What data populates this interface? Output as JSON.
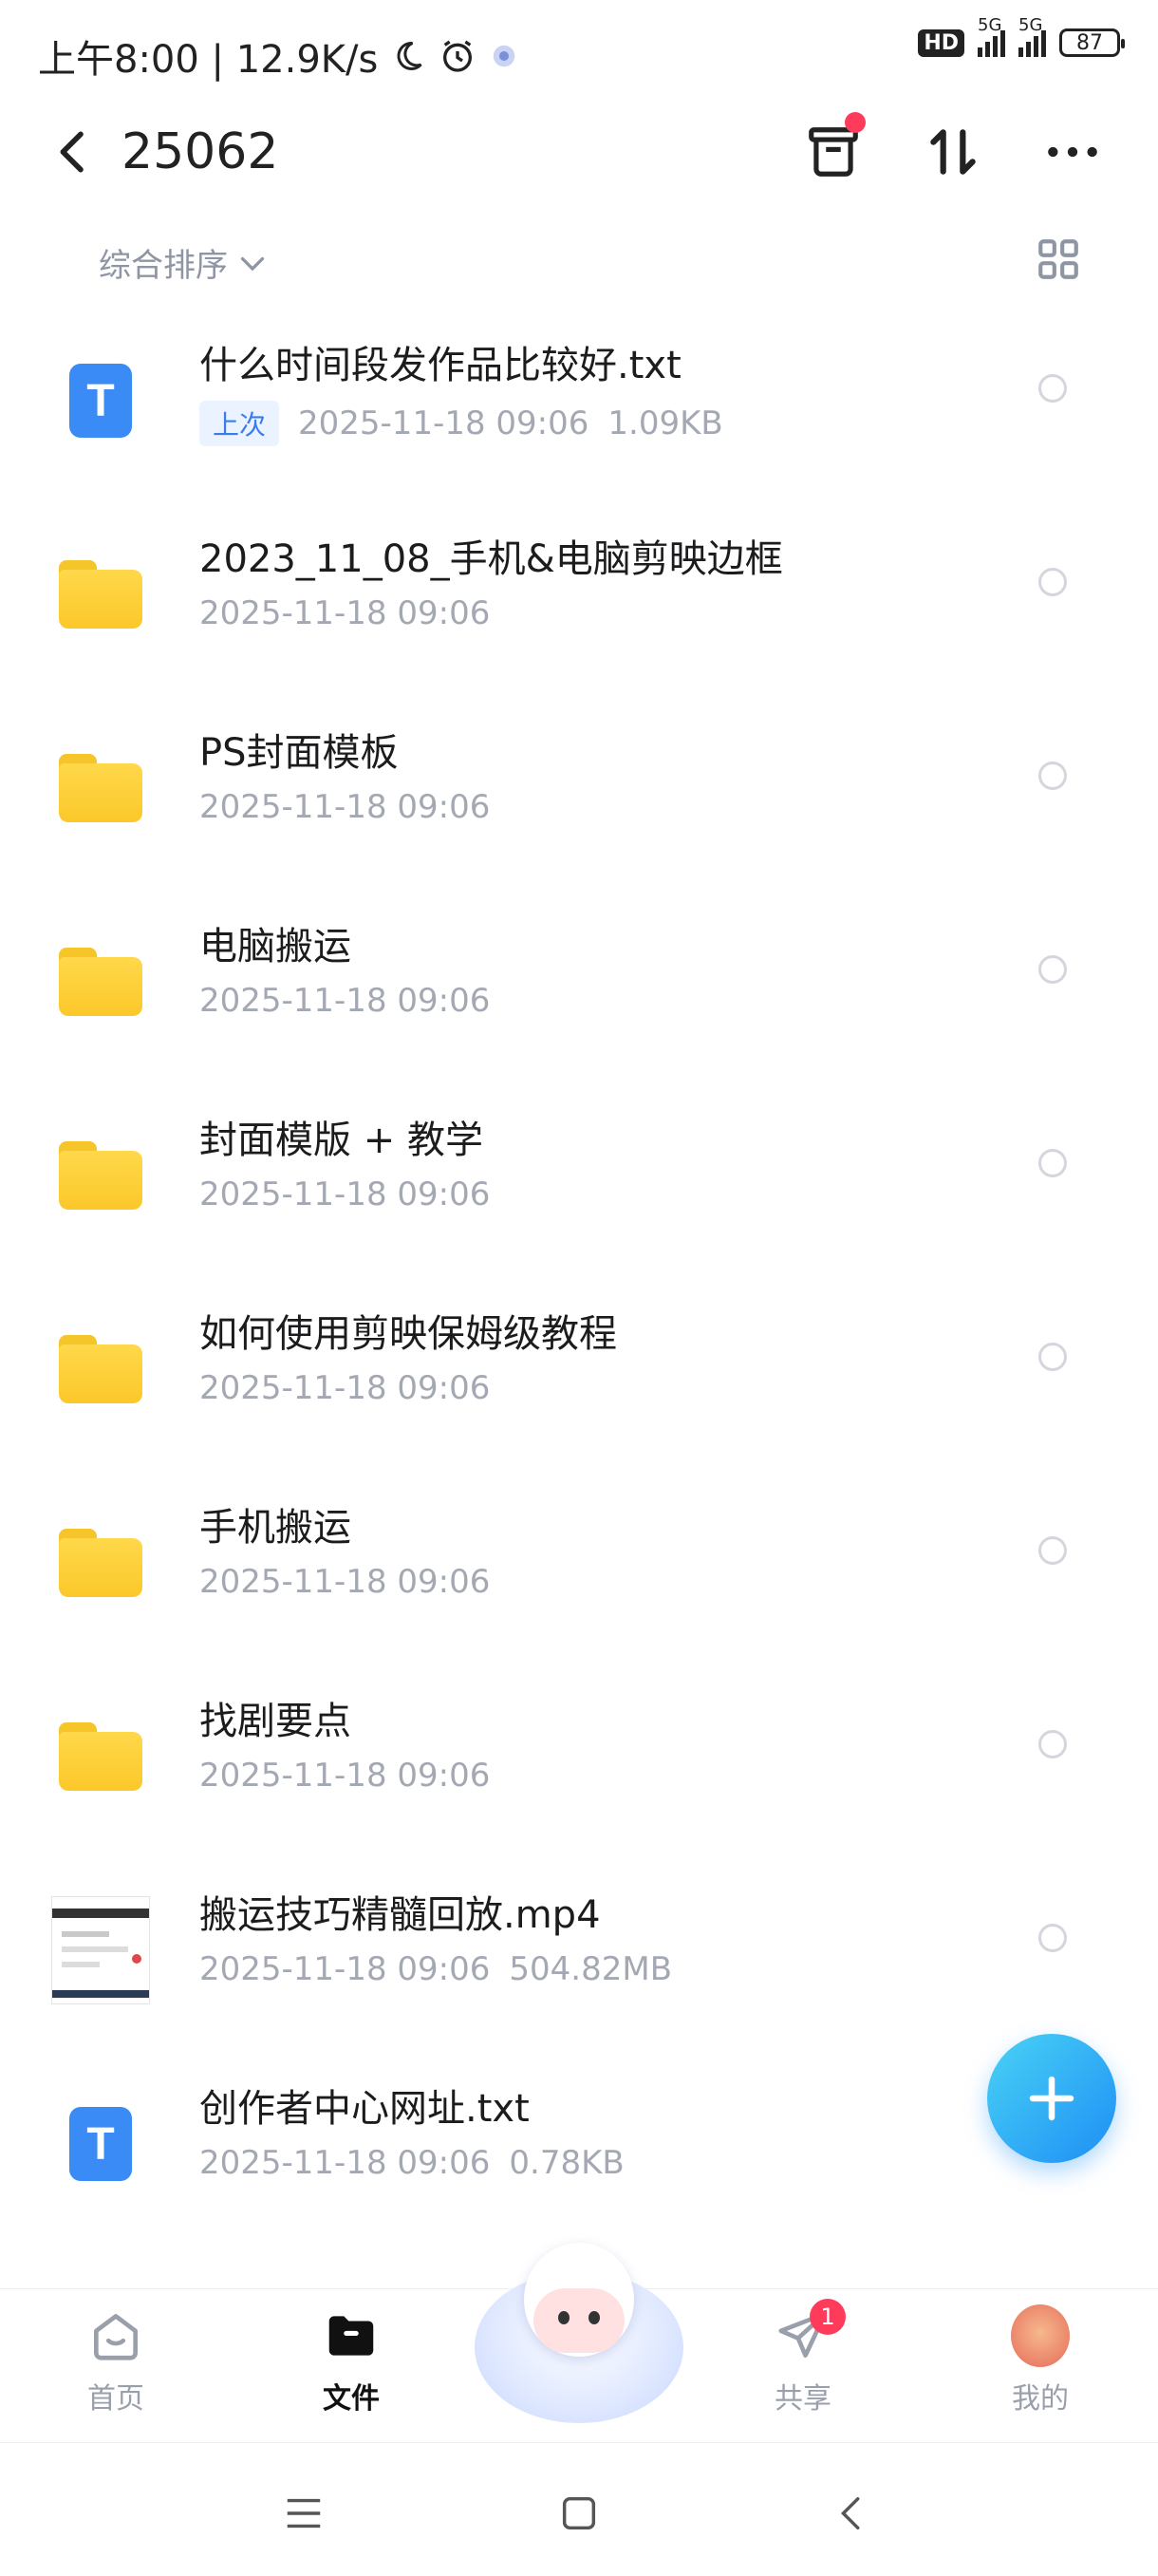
{
  "status_bar": {
    "time_speed": "上午8:00 | 12.9K/s",
    "hd": "HD",
    "net1": "5G",
    "net2": "5G",
    "battery": "87"
  },
  "header": {
    "title": "25062"
  },
  "sortbar": {
    "label": "综合排序"
  },
  "files": [
    {
      "name": "什么时间段发作品比较好.txt",
      "badge": "上次",
      "date": "2025-11-18  09:06",
      "size": "1.09KB",
      "type": "txt"
    },
    {
      "name": "2023_11_08_手机&电脑剪映边框",
      "date": "2025-11-18  09:06",
      "type": "folder"
    },
    {
      "name": "PS封面模板",
      "date": "2025-11-18  09:06",
      "type": "folder"
    },
    {
      "name": "电脑搬运",
      "date": "2025-11-18  09:06",
      "type": "folder"
    },
    {
      "name": "封面模版 + 教学",
      "date": "2025-11-18  09:06",
      "type": "folder"
    },
    {
      "name": "如何使用剪映保姆级教程",
      "date": "2025-11-18  09:06",
      "type": "folder"
    },
    {
      "name": "手机搬运",
      "date": "2025-11-18  09:06",
      "type": "folder"
    },
    {
      "name": "找剧要点",
      "date": "2025-11-18  09:06",
      "type": "folder"
    },
    {
      "name": "搬运技巧精髓回放.mp4",
      "date": "2025-11-18  09:06",
      "size": "504.82MB",
      "type": "video"
    },
    {
      "name": "创作者中心网址.txt",
      "date": "2025-11-18  09:06",
      "size": "0.78KB",
      "type": "txt"
    }
  ],
  "txt_glyph": "T",
  "tabbar": {
    "home": "首页",
    "files": "文件",
    "share": "共享",
    "share_badge": "1",
    "me": "我的"
  }
}
